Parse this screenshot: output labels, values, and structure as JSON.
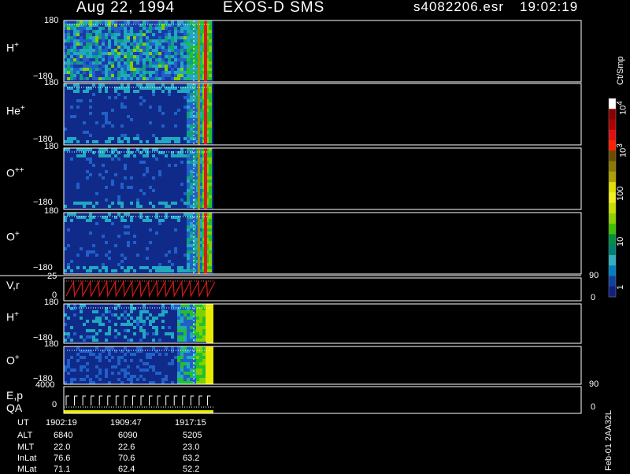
{
  "header": {
    "date": "Aug 22, 1994",
    "instrument": "EXOS-D SMS",
    "filename": "s4082206.esr",
    "time": "19:02:19"
  },
  "panels": [
    {
      "species": "H",
      "charge": "+",
      "ytop": "180",
      "ybot": "−180"
    },
    {
      "species": "He",
      "charge": "+",
      "ytop": "180",
      "ybot": "−180"
    },
    {
      "species": "O",
      "charge": "++",
      "ytop": "180",
      "ybot": "−180"
    },
    {
      "species": "O",
      "charge": "+",
      "ytop": "180",
      "ybot": "−180"
    },
    {
      "species": "V,r",
      "charge": "",
      "ytop": "25",
      "ybot": "0",
      "rtop": "90",
      "rbot": "0"
    },
    {
      "species": "H",
      "charge": "+",
      "ytop": "180",
      "ybot": "−180"
    },
    {
      "species": "O",
      "charge": "+",
      "ytop": "180",
      "ybot": "−180"
    },
    {
      "species": "E,p",
      "species2": "QA",
      "charge": "",
      "ytop": "4000",
      "ybot": "0",
      "rtop": "90",
      "rbot": "0"
    }
  ],
  "colorbar": {
    "unit": "Ct/Smp",
    "ticks": [
      {
        "base": "10",
        "exp": "4"
      },
      {
        "base": "10",
        "exp": "3"
      },
      {
        "base": "100",
        "exp": ""
      },
      {
        "base": "10",
        "exp": ""
      },
      {
        "base": "1",
        "exp": ""
      }
    ],
    "colors": [
      "#ffffff",
      "#8b0000",
      "#b00000",
      "#e01010",
      "#ff2000",
      "#6b4c00",
      "#8a7a00",
      "#b0a000",
      "#e0e000",
      "#f0f020",
      "#c8e000",
      "#90d000",
      "#40c000",
      "#009040",
      "#008070",
      "#30b0c0",
      "#0080c0",
      "#1040a0",
      "#102080"
    ]
  },
  "footer": {
    "rows": [
      {
        "label": "UT",
        "values": [
          "1902:19",
          "1909:47",
          "1917:15"
        ]
      },
      {
        "label": "ALT",
        "values": [
          "6840",
          "6090",
          "5205"
        ]
      },
      {
        "label": "MLT",
        "values": [
          "22.0",
          "22.6",
          "23.0"
        ]
      },
      {
        "label": "InLat",
        "values": [
          "76.6",
          "70.6",
          "63.2"
        ]
      },
      {
        "label": "MLat",
        "values": [
          "71.1",
          "62.4",
          "52.2"
        ]
      }
    ],
    "version": "Feb-01 2AA32L"
  },
  "chart_data": {
    "type": "heatmap",
    "title": "Aug 22, 1994   EXOS-D SMS",
    "xlabel": "UT",
    "x_ticks": [
      "1902:19",
      "1909:47",
      "1917:15"
    ],
    "series": [
      {
        "name": "H+",
        "ylim": [
          -180,
          180
        ]
      },
      {
        "name": "He+",
        "ylim": [
          -180,
          180
        ]
      },
      {
        "name": "O++",
        "ylim": [
          -180,
          180
        ]
      },
      {
        "name": "O+",
        "ylim": [
          -180,
          180
        ]
      },
      {
        "name": "V,r",
        "ylim": [
          0,
          25
        ],
        "y2lim": [
          0,
          90
        ]
      },
      {
        "name": "H+",
        "ylim": [
          -180,
          180
        ]
      },
      {
        "name": "O+",
        "ylim": [
          -180,
          180
        ]
      },
      {
        "name": "E,p",
        "ylim": [
          0,
          4000
        ],
        "y2lim": [
          0,
          90
        ]
      }
    ],
    "colorscale": {
      "unit": "Ct/Smp",
      "scale": "log",
      "range": [
        1,
        10000
      ]
    }
  }
}
